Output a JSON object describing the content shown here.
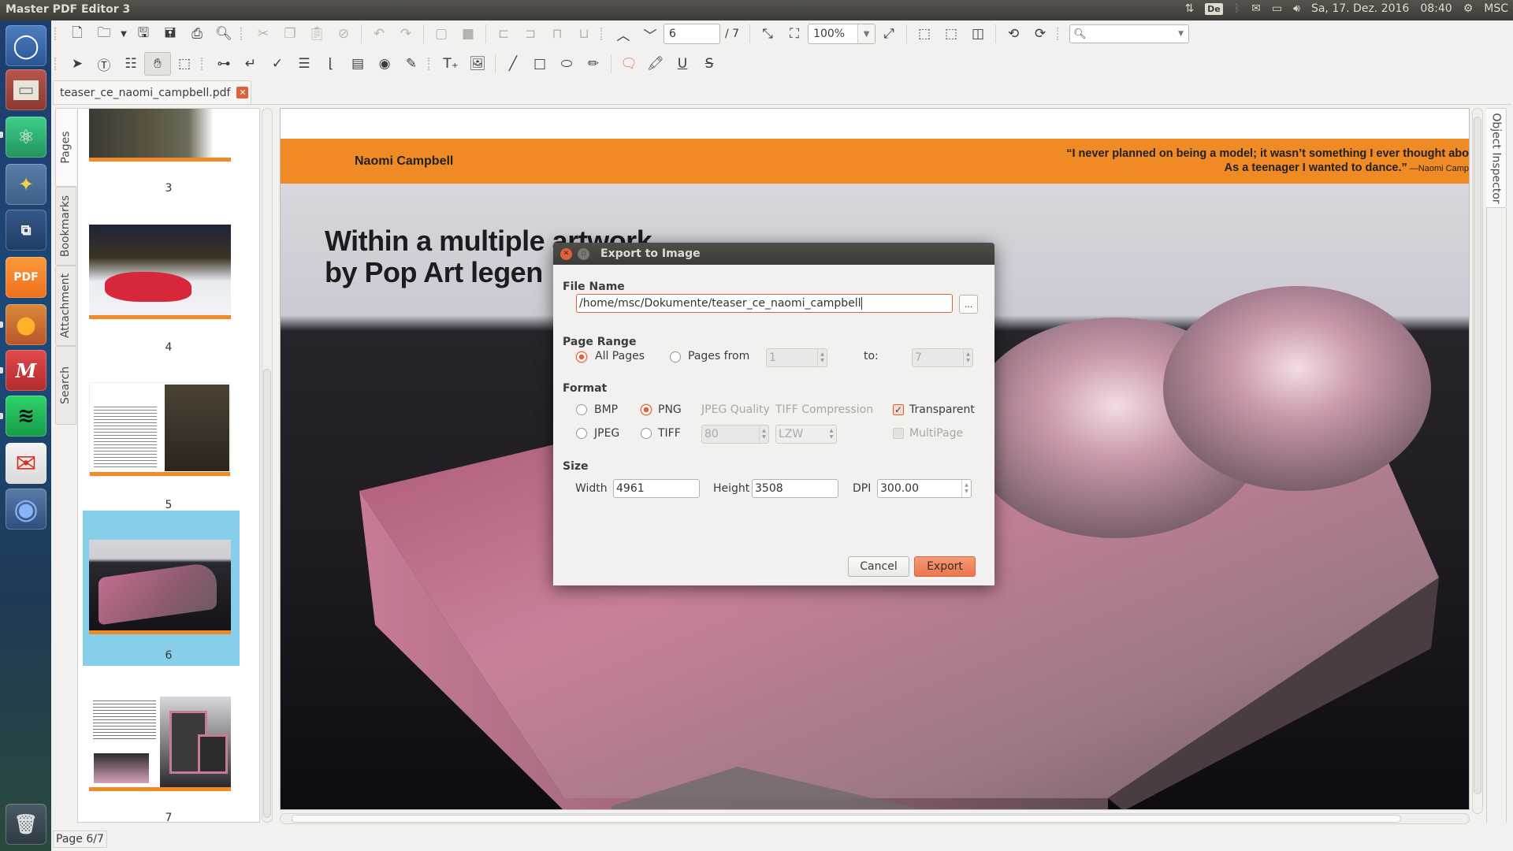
{
  "topbar": {
    "app_title": "Master PDF Editor 3",
    "keyboard_layout": "De",
    "datetime": "Sa, 17. Dez. 2016",
    "time": "08:40",
    "user": "MSC"
  },
  "launcher": {
    "items": [
      {
        "name": "dash-home",
        "glyph": "◯",
        "color": "#3a6aa8"
      },
      {
        "name": "files",
        "glyph": "▭",
        "color": "#8a5a4a"
      },
      {
        "name": "atom",
        "glyph": "⚛",
        "color": "#2fa66b"
      },
      {
        "name": "bleachbit",
        "glyph": "✦",
        "color": "#4d6a8f"
      },
      {
        "name": "workspace-switcher",
        "glyph": "⧉",
        "color": "#2a4e7a"
      },
      {
        "name": "master-pdf-editor",
        "glyph": "G",
        "color": "#f07a24"
      },
      {
        "name": "firefox",
        "glyph": "🦊",
        "color": "#d2652a"
      },
      {
        "name": "mendeley",
        "glyph": "M",
        "color": "#c8363a"
      },
      {
        "name": "spotify",
        "glyph": "≋",
        "color": "#1db954"
      },
      {
        "name": "gmail",
        "glyph": "✉",
        "color": "#d93025"
      },
      {
        "name": "chromium",
        "glyph": "◉",
        "color": "#3d77c9"
      },
      {
        "name": "trash",
        "glyph": "🗑",
        "color": "#5c6a70"
      }
    ]
  },
  "toolbar": {
    "current_page": "6",
    "total_pages": "/ 7",
    "zoom": "100%",
    "search_placeholder": ""
  },
  "document_tab": {
    "label": "teaser_ce_naomi_campbell.pdf"
  },
  "side_tabs": {
    "pages": "Pages",
    "bookmarks": "Bookmarks",
    "attachment": "Attachment",
    "search": "Search",
    "object_inspector": "Object Inspector"
  },
  "thumbnails": [
    {
      "page": "3"
    },
    {
      "page": "4"
    },
    {
      "page": "5"
    },
    {
      "page": "6",
      "selected": true
    },
    {
      "page": "7"
    }
  ],
  "document_page": {
    "header_name": "Naomi Campbell",
    "quote_line1": "“I never planned on being a model; it wasn’t something I ever thought abo",
    "quote_line2": "As a teenager I wanted to dance.”",
    "quote_by": " —Naomi Camp",
    "headline_line1": "Within a multiple artwork",
    "headline_line2": "by Pop Art legen",
    "accent_color": "#f08a24"
  },
  "status_bar": {
    "page_indicator": "Page 6/7"
  },
  "dialog": {
    "title": "Export to Image",
    "file_name_section": "File Name",
    "file_name_value": "/home/msc/Dokumente/teaser_ce_naomi_campbell",
    "browse_label": "...",
    "page_range_section": "Page Range",
    "all_pages_label": "All Pages",
    "pages_from_label": "Pages from",
    "pages_from_value": "1",
    "to_label": "to:",
    "to_value": "7",
    "page_range_selected": "All Pages",
    "format_section": "Format",
    "formats": [
      "BMP",
      "PNG",
      "JPEG",
      "TIFF"
    ],
    "format_selected": "PNG",
    "jpeg_quality_label": "JPEG Quality",
    "jpeg_quality_value": "80",
    "tiff_compression_label": "TIFF Compression",
    "tiff_compression_value": "LZW",
    "transparent_label": "Transparent",
    "transparent_checked": true,
    "multipage_label": "MultiPage",
    "multipage_checked": false,
    "size_section": "Size",
    "width_label": "Width",
    "width_value": "4961",
    "height_label": "Height",
    "height_value": "3508",
    "dpi_label": "DPI",
    "dpi_value": "300.00",
    "cancel_label": "Cancel",
    "export_label": "Export"
  }
}
